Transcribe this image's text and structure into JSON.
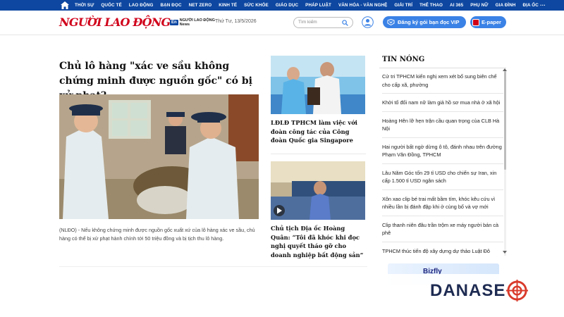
{
  "nav": {
    "items": [
      "THỜI SỰ",
      "QUỐC TẾ",
      "LAO ĐỘNG",
      "BẠN ĐỌC",
      "NET ZERO",
      "KINH TẾ",
      "SỨC KHỎE",
      "GIÁO DỤC",
      "PHÁP LUẬT",
      "VĂN HÓA - VĂN NGHỆ",
      "GIẢI TRÍ",
      "THỂ THAO",
      "AI 365",
      "PHỤ NỮ",
      "GIA ĐÌNH",
      "ĐỊA ỐC"
    ],
    "more": "···"
  },
  "header": {
    "logo": "NGƯỜI LAO ĐỘNG",
    "en_badge": "En",
    "en_text_1": "NGƯỜI LAO ĐỘNG",
    "en_text_2": "News",
    "date": "Thứ Tư, 13/5/2026",
    "search_placeholder": "Tìm kiếm",
    "vip_label": "Đăng ký gói bạn đọc VIP",
    "epaper_label": "E-paper"
  },
  "main": {
    "title": "Chủ lô hàng \"xác ve sầu không chứng minh được nguồn gốc\" có bị xử phạt?",
    "sapo": "(NLĐO) - Nếu không chứng minh được nguồn gốc xuất xứ của lô hàng xác ve sầu, chủ hàng có thể bị xử phạt hành chính tới 50 triệu đồng và bị tịch thu lô hàng."
  },
  "secondary": [
    {
      "title": "LĐLĐ TPHCM làm việc với đoàn công tác của Công đoàn Quốc gia Singapore"
    },
    {
      "title": "Chủ tịch Địa ốc Hoàng Quân: “Tôi đã khóc khi đọc nghị quyết tháo gỡ cho doanh nghiệp bất động sản”"
    }
  ],
  "hot": {
    "title": "TIN NÓNG",
    "items": [
      "Cử tri TPHCM kiến nghị xem xét bổ sung biên chế cho cấp xã, phường",
      "Khởi tố đối nam nữ làm giả hồ sơ mua nhà ở xã hội",
      "Hoàng Hên lỡ hẹn trận cầu quan trọng của CLB Hà Nội",
      "Hai người bất ngờ dừng ô tô, đánh nhau trên đường Phạm Văn Đồng, TPHCM",
      "Lâu Năm Góc tốn 29 tỉ USD cho chiến sự Iran, xin cấp 1.500 tỉ USD ngân sách",
      "Xôn xao clip bé trai mất bầm tím, khóc kêu cứu vì nhiều lần bị đánh đập khi ở cùng bố và vợ mới",
      "Clip thanh niên đâu trần trộm xe máy người bán cà phê",
      "TPHCM thúc tiến độ xây dựng dự thảo Luật Đô"
    ]
  },
  "ad": {
    "label": "Bizfly"
  },
  "watermark": {
    "prefix": "DANASE"
  }
}
